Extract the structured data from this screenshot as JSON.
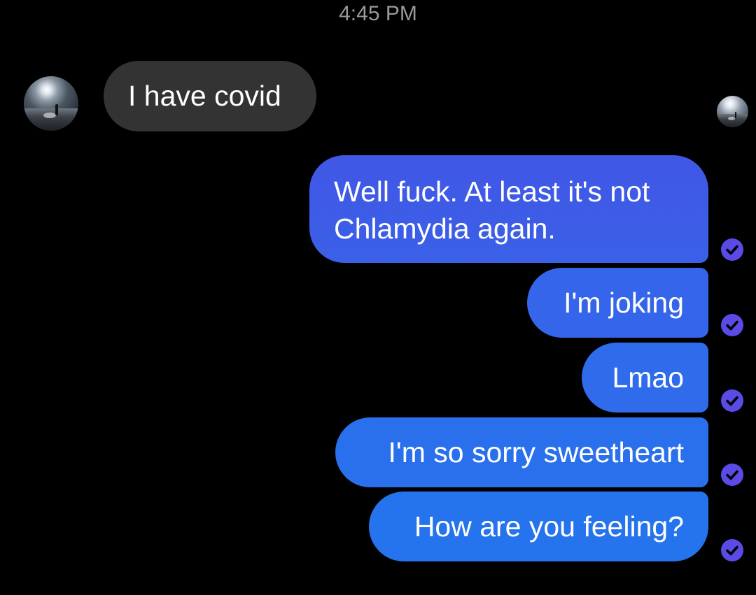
{
  "conversation": {
    "timestamp": "4:45 PM",
    "messages": [
      {
        "sender": "contact",
        "text": "I have covid"
      },
      {
        "sender": "me",
        "text": "Well fuck. At least it's not Chlamydia again.",
        "status": "sent"
      },
      {
        "sender": "me",
        "text": "I'm joking",
        "status": "sent"
      },
      {
        "sender": "me",
        "text": "Lmao",
        "status": "sent"
      },
      {
        "sender": "me",
        "text": "I'm so sorry sweetheart",
        "status": "sent"
      },
      {
        "sender": "me",
        "text": "How are you feeling?",
        "status": "sent"
      }
    ]
  },
  "icons": {
    "status": "check-circle-icon",
    "contact_avatar": "beach-sunset-avatar",
    "seen_indicator": "beach-sunset-avatar"
  },
  "colors": {
    "background": "#000000",
    "incoming_bubble": "#333333",
    "outgoing_bubble_top": "#4057e5",
    "outgoing_bubble_bottom": "#2574ed",
    "check_icon": "#5b4be6",
    "timestamp_text": "#9a9a9a"
  }
}
